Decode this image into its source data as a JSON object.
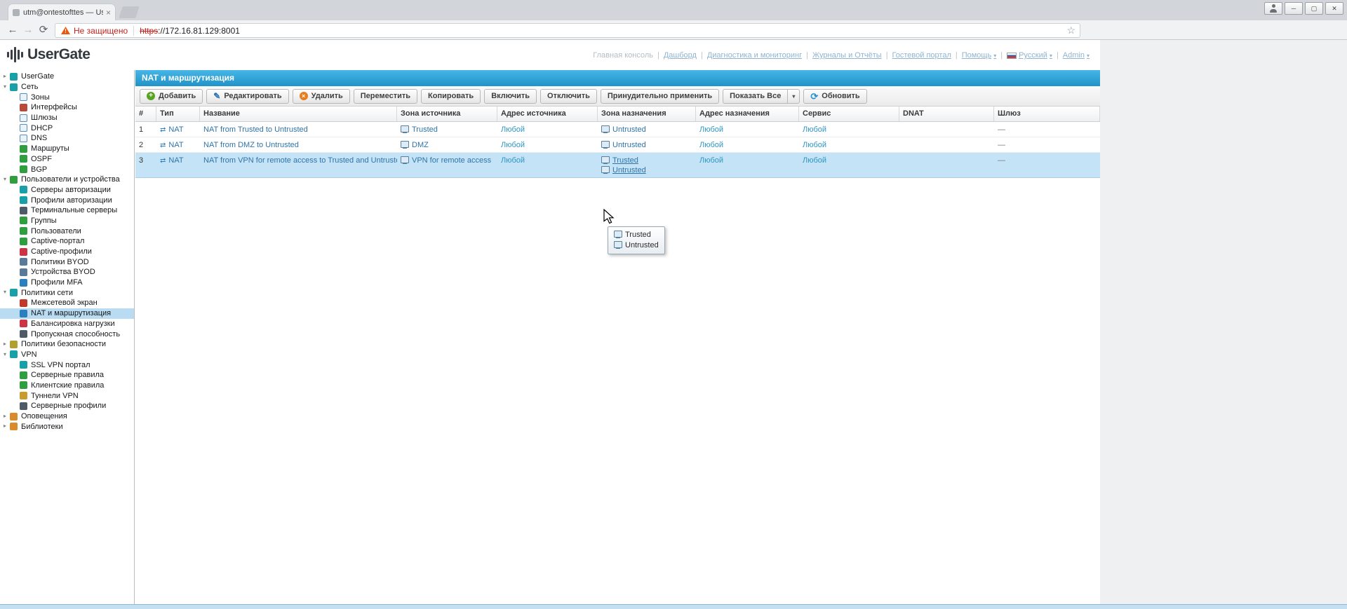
{
  "browser": {
    "tab": {
      "title": "utm@ontestofttes — Us",
      "close_glyph": "×"
    },
    "window_controls": {
      "minimize": "─",
      "maximize": "▢",
      "close": "✕"
    },
    "nav": {
      "back": "←",
      "forward": "→",
      "reload": "⟳",
      "star": "☆"
    },
    "address": {
      "warning": "Не защищено",
      "protocol": "https",
      "rest": "://172.16.81.129:8001"
    }
  },
  "header": {
    "logo": "UserGate",
    "links": [
      {
        "label": "Главная консоль"
      },
      {
        "label": "Дашборд"
      },
      {
        "label": "Диагностика и мониторинг"
      },
      {
        "label": "Журналы и Отчёты"
      },
      {
        "label": "Гостевой портал"
      },
      {
        "label": "Помощь"
      },
      {
        "label": "Русский"
      },
      {
        "label": "Admin"
      }
    ]
  },
  "sidebar": {
    "items": [
      {
        "label": "UserGate",
        "icon": "globe-icon",
        "depth": 0,
        "arrow": "collapsed"
      },
      {
        "label": "Сеть",
        "icon": "network-globe-icon",
        "depth": 0,
        "arrow": "expanded"
      },
      {
        "label": "Зоны",
        "icon": "zones-icon",
        "depth": 1
      },
      {
        "label": "Интерфейсы",
        "icon": "interfaces-icon",
        "depth": 1
      },
      {
        "label": "Шлюзы",
        "icon": "gateways-icon",
        "depth": 1
      },
      {
        "label": "DHCP",
        "icon": "dhcp-icon",
        "depth": 1
      },
      {
        "label": "DNS",
        "icon": "dns-icon",
        "depth": 1
      },
      {
        "label": "Маршруты",
        "icon": "routes-icon",
        "depth": 1
      },
      {
        "label": "OSPF",
        "icon": "ospf-icon",
        "depth": 1
      },
      {
        "label": "BGP",
        "icon": "bgp-icon",
        "depth": 1
      },
      {
        "label": "Пользователи и устройства",
        "icon": "users-devices-icon",
        "depth": 0,
        "arrow": "expanded"
      },
      {
        "label": "Серверы авторизации",
        "icon": "auth-servers-icon",
        "depth": 1
      },
      {
        "label": "Профили авторизации",
        "icon": "auth-profiles-icon",
        "depth": 1
      },
      {
        "label": "Терминальные серверы",
        "icon": "terminal-servers-icon",
        "depth": 1
      },
      {
        "label": "Группы",
        "icon": "groups-icon",
        "depth": 1
      },
      {
        "label": "Пользователи",
        "icon": "users-icon",
        "depth": 1
      },
      {
        "label": "Captive-портал",
        "icon": "captive-portal-icon",
        "depth": 1
      },
      {
        "label": "Captive-профили",
        "icon": "captive-profiles-icon",
        "depth": 1
      },
      {
        "label": "Политики BYOD",
        "icon": "byod-policies-icon",
        "depth": 1
      },
      {
        "label": "Устройства BYOD",
        "icon": "byod-devices-icon",
        "depth": 1
      },
      {
        "label": "Профили MFA",
        "icon": "mfa-profiles-icon",
        "depth": 1
      },
      {
        "label": "Политики сети",
        "icon": "network-policies-icon",
        "depth": 0,
        "arrow": "expanded"
      },
      {
        "label": "Межсетевой экран",
        "icon": "firewall-icon",
        "depth": 1
      },
      {
        "label": "NAT и маршрутизация",
        "icon": "nat-routing-icon",
        "depth": 1,
        "selected": true
      },
      {
        "label": "Балансировка нагрузки",
        "icon": "load-balancing-icon",
        "depth": 1
      },
      {
        "label": "Пропускная способность",
        "icon": "bandwidth-icon",
        "depth": 1
      },
      {
        "label": "Политики безопасности",
        "icon": "security-policies-icon",
        "depth": 0,
        "arrow": "collapsed"
      },
      {
        "label": "VPN",
        "icon": "vpn-icon",
        "depth": 0,
        "arrow": "expanded"
      },
      {
        "label": "SSL VPN портал",
        "icon": "ssl-vpn-portal-icon",
        "depth": 1
      },
      {
        "label": "Серверные правила",
        "icon": "server-rules-icon",
        "depth": 1
      },
      {
        "label": "Клиентские правила",
        "icon": "client-rules-icon",
        "depth": 1
      },
      {
        "label": "Туннели VPN",
        "icon": "vpn-tunnels-icon",
        "depth": 1
      },
      {
        "label": "Серверные профили",
        "icon": "server-profiles-icon",
        "depth": 1
      },
      {
        "label": "Оповещения",
        "icon": "notifications-icon",
        "depth": 0,
        "arrow": "collapsed"
      },
      {
        "label": "Библиотеки",
        "icon": "libraries-icon",
        "depth": 0,
        "arrow": "collapsed"
      }
    ]
  },
  "main": {
    "title": "NAT и маршрутизация",
    "toolbar": {
      "buttons": [
        {
          "label": "Добавить",
          "icon": "add-icon"
        },
        {
          "label": "Редактировать",
          "icon": "edit-icon"
        },
        {
          "label": "Удалить",
          "icon": "delete-icon"
        },
        {
          "label": "Переместить"
        },
        {
          "label": "Копировать"
        },
        {
          "label": "Включить"
        },
        {
          "label": "Отключить"
        },
        {
          "label": "Принудительно применить"
        },
        {
          "label": "Показать Все",
          "split": true
        },
        {
          "label": "Обновить",
          "icon": "refresh-icon"
        }
      ]
    },
    "table": {
      "columns": [
        "#",
        "Тип",
        "Название",
        "Зона источника",
        "Адрес источника",
        "Зона назначения",
        "Адрес назначения",
        "Сервис",
        "DNAT",
        "Шлюз"
      ],
      "rows": [
        {
          "num": "1",
          "type": "NAT",
          "name": "NAT from Trusted to Untrusted",
          "src_zone": "Trusted",
          "src_addr": "Любой",
          "dst_zone_1": "Untrusted",
          "dst_zone_2": "",
          "dst_addr": "Любой",
          "service": "Любой",
          "dnat": "",
          "gateway": "—"
        },
        {
          "num": "2",
          "type": "NAT",
          "name": "NAT from DMZ to Untrusted",
          "src_zone": "DMZ",
          "src_addr": "Любой",
          "dst_zone_1": "Untrusted",
          "dst_zone_2": "",
          "dst_addr": "Любой",
          "service": "Любой",
          "dnat": "",
          "gateway": "—"
        },
        {
          "num": "3",
          "type": "NAT",
          "name": "NAT from VPN for remote access to Trusted and Untrusted",
          "src_zone": "VPN for remote access",
          "src_addr": "Любой",
          "dst_zone_1": "Trusted",
          "dst_zone_2": "Untrusted",
          "dst_addr": "Любой",
          "service": "Любой",
          "dnat": "",
          "gateway": "—",
          "selected": true
        }
      ]
    },
    "tooltip": {
      "items": [
        "Trusted",
        "Untrusted"
      ]
    }
  },
  "colors": {
    "accent_blue": "#2f9fd4",
    "selection_blue": "#c5e3f6",
    "sidebar_selection": "#b9dcf2"
  }
}
